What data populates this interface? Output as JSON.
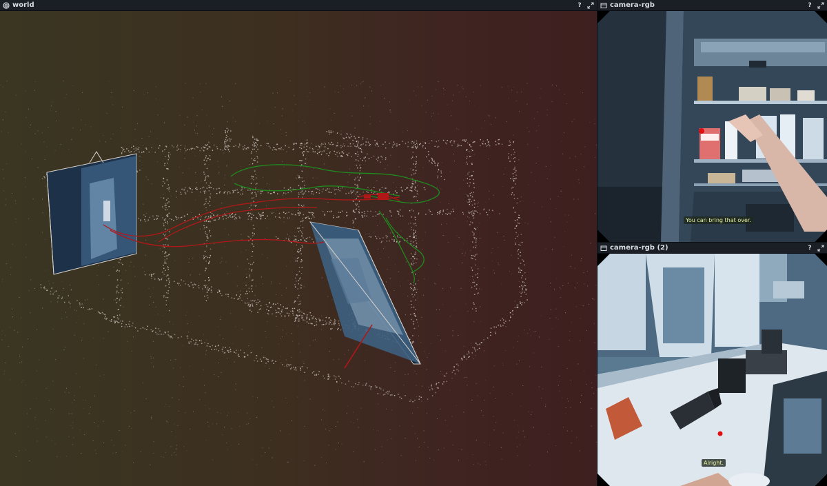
{
  "panels": {
    "world": {
      "title": "world",
      "help": "?",
      "icon": "cube-icon"
    },
    "camera1": {
      "title": "camera-rgb",
      "help": "?",
      "icon": "camera-view-icon",
      "caption": "You can bring that over."
    },
    "camera2": {
      "title": "camera-rgb (2)",
      "help": "?",
      "icon": "camera-view-icon",
      "caption": "Alright."
    }
  },
  "colors": {
    "header_bg": "#1a1f25",
    "trajectory_red": "#b01818",
    "trajectory_green": "#1f8a1f",
    "point_cloud": "#d8d2cc",
    "gaze_dot": "#e01010"
  }
}
